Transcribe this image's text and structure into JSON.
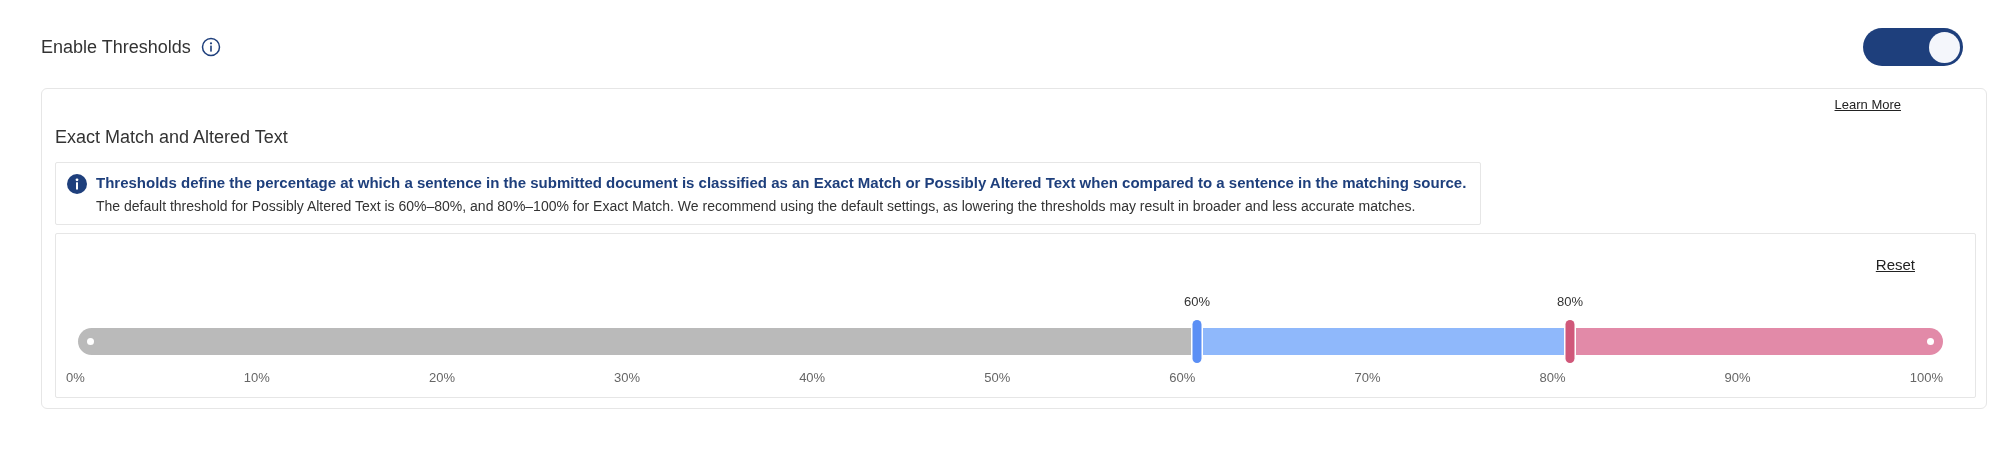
{
  "header": {
    "title": "Enable Thresholds",
    "toggle": {
      "on": true
    }
  },
  "card": {
    "link": "Learn More",
    "title": "Exact Match and Altered Text",
    "info": {
      "heading": "Thresholds define the percentage at which a sentence in the submitted document is classified as an Exact Match or Possibly Altered Text when compared to a sentence in the matching source.",
      "body": "The default threshold for Possibly Altered Text is 60%–80%, and 80%–100% for Exact Match. We recommend using the default settings, as lowering the thresholds may result in broader and less accurate matches."
    },
    "slider": {
      "reset": "Reset",
      "segments": [
        {
          "color": "#bababa"
        },
        {
          "color": "#8fb8fb"
        },
        {
          "color": "#e28aa8"
        }
      ],
      "thumbs": [
        {
          "label": "60%",
          "level": 0.6,
          "color": "#5b8ff5"
        },
        {
          "label": "80%",
          "level": 0.8,
          "color": "#d0587a"
        }
      ],
      "ticks": [
        "0%",
        "10%",
        "20%",
        "30%",
        "40%",
        "50%",
        "60%",
        "70%",
        "80%",
        "90%",
        "100%"
      ]
    }
  }
}
